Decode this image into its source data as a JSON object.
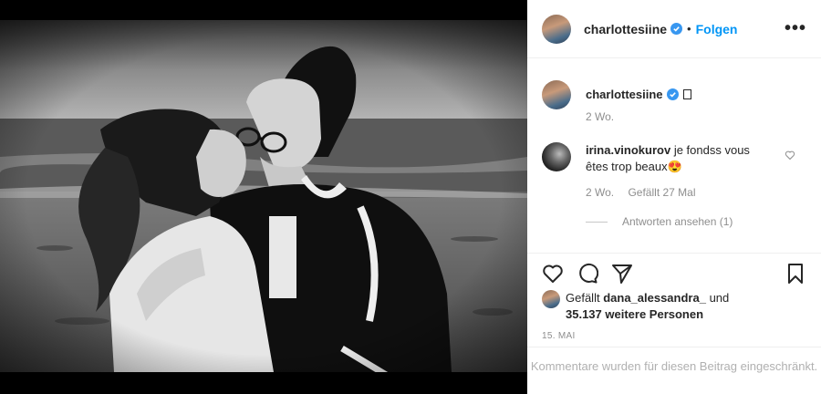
{
  "header": {
    "username": "charlottesiine",
    "separator": "•",
    "follow_label": "Folgen",
    "more_label": "•••"
  },
  "caption": {
    "username": "charlottesiine",
    "time": "2 Wo."
  },
  "comment": {
    "username": "irina.vinokurov",
    "text": "je fondss vous êtes trop beaux😍",
    "time": "2 Wo.",
    "likes": "Gefällt 27 Mal",
    "replies_label": "Antworten ansehen (1)"
  },
  "likes": {
    "prefix": "Gefällt",
    "user": "dana_alessandra_",
    "and": "und",
    "others": "35.137 weitere Personen"
  },
  "date": "15. MAI",
  "restricted_text": "Kommentare wurden für diesen Beitrag eingeschränkt.",
  "icons": {
    "like": "heart-icon",
    "comment": "comment-icon",
    "share": "share-icon",
    "save": "bookmark-icon",
    "verified": "verified-icon",
    "more": "more-icon"
  },
  "colors": {
    "follow": "#0095f6",
    "verified": "#3897f0",
    "muted": "#8e8e8e"
  }
}
